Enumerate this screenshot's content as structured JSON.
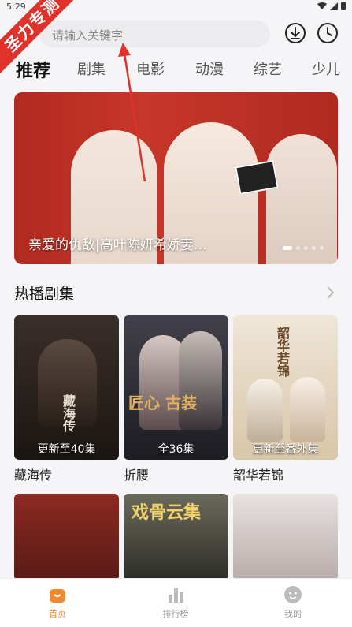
{
  "status": {
    "time": "5:29"
  },
  "badge": {
    "text": "圣力专测"
  },
  "search": {
    "placeholder": "请输入关键字"
  },
  "tabs": [
    {
      "label": "推荐",
      "active": true
    },
    {
      "label": "剧集"
    },
    {
      "label": "电影"
    },
    {
      "label": "动漫"
    },
    {
      "label": "综艺"
    },
    {
      "label": "少儿"
    }
  ],
  "banner": {
    "title": "亲爱的仇敌|高叶陈妍希娇妻…",
    "dots": 5,
    "active_dot": 0
  },
  "section": {
    "title": "热播剧集"
  },
  "cards": [
    {
      "title": "藏海传",
      "caption": "更新至40集",
      "poster_text": "藏海传"
    },
    {
      "title": "折腰",
      "caption": "全36集",
      "poster_text": "匠心 古装"
    },
    {
      "title": "韶华若锦",
      "caption": "更新至番外集",
      "poster_text": "韶华若锦"
    }
  ],
  "row2": {
    "poster_text": "戏骨云集"
  },
  "nav": [
    {
      "label": "首页",
      "icon": "home-icon",
      "active": true
    },
    {
      "label": "排行榜",
      "icon": "ranking-icon"
    },
    {
      "label": "我的",
      "icon": "profile-icon"
    }
  ],
  "colors": {
    "accent": "#f08a30",
    "badge": "#e0322a",
    "arrow": "#e0322a"
  }
}
